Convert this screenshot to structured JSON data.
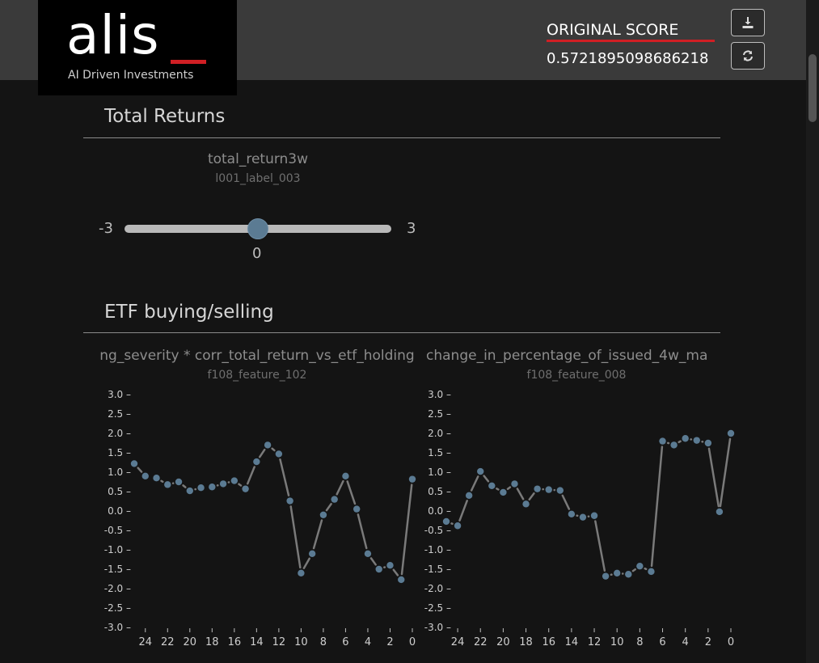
{
  "header": {
    "logo_text": "alis",
    "logo_tagline": "AI Driven Investments",
    "score_label": "ORIGINAL SCORE",
    "score_value": "0.5721895098686218",
    "download_icon": "download-icon",
    "refresh_icon": "refresh-icon"
  },
  "colors": {
    "accent": "#d01f24",
    "marker": "#5b7b93",
    "line": "#7a7a7a"
  },
  "sections": {
    "total_returns": {
      "title": "Total Returns",
      "feature_name": "total_return3w",
      "feature_code": "l001_label_003",
      "slider_min": "-3",
      "slider_max": "3",
      "slider_value": "0"
    },
    "etf": {
      "title": "ETF buying/selling"
    }
  },
  "chart_data": [
    {
      "type": "line",
      "title": "ng_severity * corr_total_return_vs_etf_holding",
      "subtitle": "f108_feature_102",
      "x": [
        25,
        24,
        23,
        22,
        21,
        20,
        19,
        18,
        17,
        16,
        15,
        14,
        13,
        12,
        11,
        10,
        9,
        8,
        7,
        6,
        5,
        4,
        3,
        2,
        1,
        0
      ],
      "values": [
        1.22,
        0.9,
        0.85,
        0.68,
        0.75,
        0.52,
        0.6,
        0.62,
        0.7,
        0.78,
        0.57,
        1.27,
        1.7,
        1.47,
        0.26,
        -1.6,
        -1.1,
        -0.1,
        0.3,
        0.9,
        0.05,
        -1.1,
        -1.5,
        -1.4,
        -1.77,
        0.82
      ],
      "ylim": [
        -3,
        3
      ],
      "yticks": [
        "3.0",
        "2.5",
        "2.0",
        "1.5",
        "1.0",
        "0.5",
        "0.0",
        "-0.5",
        "-1.0",
        "-1.5",
        "-2.0",
        "-2.5",
        "-3.0"
      ],
      "xticks": [
        "24",
        "22",
        "20",
        "18",
        "16",
        "14",
        "12",
        "10",
        "8",
        "6",
        "4",
        "2",
        "0"
      ]
    },
    {
      "type": "line",
      "title": "change_in_percentage_of_issued_4w_ma",
      "subtitle": "f108_feature_008",
      "x": [
        25,
        24,
        23,
        22,
        21,
        20,
        19,
        18,
        17,
        16,
        15,
        14,
        13,
        12,
        11,
        10,
        9,
        8,
        7,
        6,
        5,
        4,
        3,
        2,
        1,
        0
      ],
      "values": [
        -0.27,
        -0.38,
        0.4,
        1.02,
        0.65,
        0.48,
        0.7,
        0.18,
        0.57,
        0.55,
        0.53,
        -0.08,
        -0.16,
        -0.12,
        -1.68,
        -1.6,
        -1.63,
        -1.42,
        -1.56,
        1.8,
        1.7,
        1.87,
        1.82,
        1.75,
        -0.02,
        2.0
      ],
      "ylim": [
        -3,
        3
      ],
      "yticks": [
        "3.0",
        "2.5",
        "2.0",
        "1.5",
        "1.0",
        "0.5",
        "0.0",
        "-0.5",
        "-1.0",
        "-1.5",
        "-2.0",
        "-2.5",
        "-3.0"
      ],
      "xticks": [
        "24",
        "22",
        "20",
        "18",
        "16",
        "14",
        "12",
        "10",
        "8",
        "6",
        "4",
        "2",
        "0"
      ]
    }
  ]
}
